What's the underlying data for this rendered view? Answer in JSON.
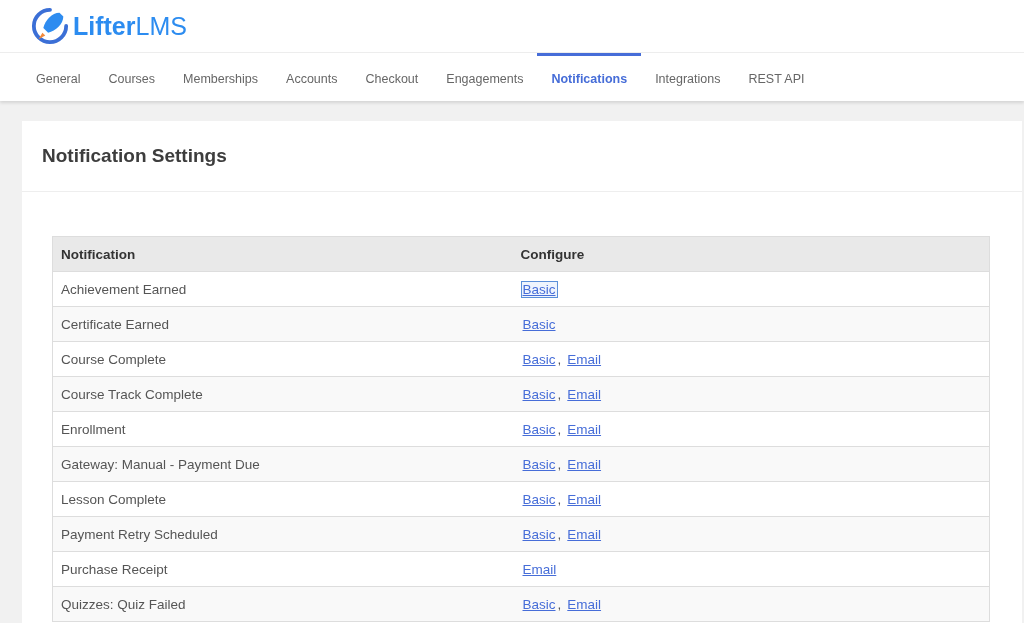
{
  "brand": {
    "name": "**Lifter**LMS"
  },
  "tabs": [
    {
      "label": "General",
      "selected": false
    },
    {
      "label": "Courses",
      "selected": false
    },
    {
      "label": "Memberships",
      "selected": false
    },
    {
      "label": "Accounts",
      "selected": false
    },
    {
      "label": "Checkout",
      "selected": false
    },
    {
      "label": "Engagements",
      "selected": false
    },
    {
      "label": "Notifications",
      "selected": true
    },
    {
      "label": "Integrations",
      "selected": false
    },
    {
      "label": "REST API",
      "selected": false
    }
  ],
  "panel": {
    "title": "Notification Settings"
  },
  "table": {
    "columns": [
      "Notification",
      "Configure"
    ],
    "rows": [
      {
        "name": "Achievement Earned",
        "links": [
          {
            "label": "Basic",
            "focused": true
          }
        ]
      },
      {
        "name": "Certificate Earned",
        "links": [
          {
            "label": "Basic",
            "focused": false
          }
        ]
      },
      {
        "name": "Course Complete",
        "separator": ",",
        "links": [
          {
            "label": "Basic",
            "focused": false
          },
          {
            "label": "Email",
            "focused": false
          }
        ]
      },
      {
        "name": "Course Track Complete",
        "separator": ",",
        "links": [
          {
            "label": "Basic",
            "focused": false
          },
          {
            "label": "Email",
            "focused": false
          }
        ]
      },
      {
        "name": "Enrollment",
        "separator": ",",
        "links": [
          {
            "label": "Basic",
            "focused": false
          },
          {
            "label": "Email",
            "focused": false
          }
        ]
      },
      {
        "name": "Gateway: Manual - Payment Due",
        "separator": ",",
        "links": [
          {
            "label": "Basic",
            "focused": false
          },
          {
            "label": "Email",
            "focused": false
          }
        ]
      },
      {
        "name": "Lesson Complete",
        "separator": ",",
        "links": [
          {
            "label": "Basic",
            "focused": false
          },
          {
            "label": "Email",
            "focused": false
          }
        ]
      },
      {
        "name": "Payment Retry Scheduled",
        "separator": ",",
        "links": [
          {
            "label": "Basic",
            "focused": false
          },
          {
            "label": "Email",
            "focused": false
          }
        ]
      },
      {
        "name": "Purchase Receipt",
        "links": [
          {
            "label": "Email",
            "focused": false
          }
        ]
      },
      {
        "name": "Quizzes: Quiz Failed",
        "separator": ",",
        "links": [
          {
            "label": "Basic",
            "focused": false
          },
          {
            "label": "Email",
            "focused": false
          }
        ]
      }
    ]
  }
}
